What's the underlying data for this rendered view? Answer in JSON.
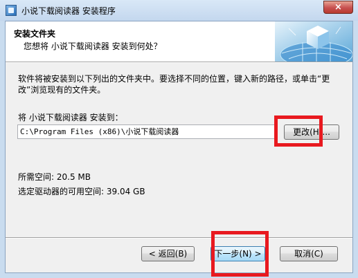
{
  "window": {
    "title": "小说下载阅读器 安装程序",
    "close_label": "×"
  },
  "header": {
    "title": "安装文件夹",
    "subtitle": "您想将 小说下载阅读器 安装到何处？"
  },
  "main": {
    "description": "软件将被安装到以下列出的文件夹中。要选择不同的位置，键入新的路径，或单击“更改”浏览现有的文件夹。",
    "install_label": "将 小说下载阅读器 安装到：",
    "install_path": "C:\\Program Files (x86)\\小说下载阅读器",
    "browse_button": "更改(H)...",
    "space_required": "所需空间: 20.5 MB",
    "space_available": "选定驱动器的可用空间: 39.04 GB"
  },
  "footer": {
    "back_button": "< 返回(B)",
    "next_button": "下一步(N) >",
    "cancel_button": "取消(C)"
  }
}
